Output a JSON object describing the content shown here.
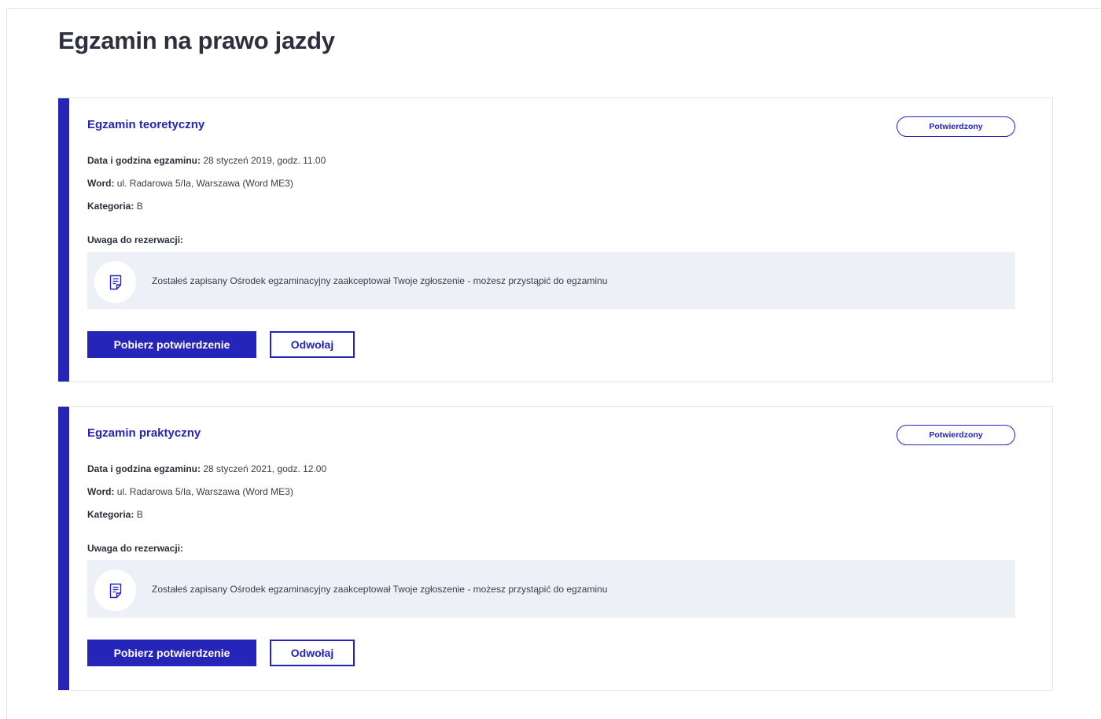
{
  "page": {
    "title": "Egzamin na prawo jazdy"
  },
  "exams": [
    {
      "title": "Egzamin teoretyczny",
      "status": "Potwierdzony",
      "date_label": "Data i godzina egzaminu:",
      "date_value": "28 styczeń 2019, godz. 11.00",
      "word_label": "Word:",
      "word_value": "ul. Radarowa 5/Ia, Warszawa (Word ME3)",
      "category_label": "Kategoria:",
      "category_value": "B",
      "note_label": "Uwaga do rezerwacji:",
      "note_icon": "document-icon",
      "note_text": "Zostałeś zapisany Ośrodek egzaminacyjny zaakceptował Twoje zgłoszenie - możesz przystąpić do egzaminu",
      "primary_button": "Pobierz potwierdzenie",
      "secondary_button": "Odwołaj"
    },
    {
      "title": "Egzamin praktyczny",
      "status": "Potwierdzony",
      "date_label": "Data i godzina egzaminu:",
      "date_value": "28 styczeń 2021, godz. 12.00",
      "word_label": "Word:",
      "word_value": "ul. Radarowa 5/Ia, Warszawa (Word ME3)",
      "category_label": "Kategoria:",
      "category_value": "B",
      "note_label": "Uwaga do rezerwacji:",
      "note_icon": "document-icon",
      "note_text": "Zostałeś zapisany Ośrodek egzaminacyjny zaakceptował Twoje zgłoszenie - możesz przystąpić do egzaminu",
      "primary_button": "Pobierz potwierdzenie",
      "secondary_button": "Odwołaj"
    }
  ],
  "colors": {
    "accent": "#2525b9",
    "note_background": "#edf0f7",
    "title_text": "#2d2f3e"
  }
}
